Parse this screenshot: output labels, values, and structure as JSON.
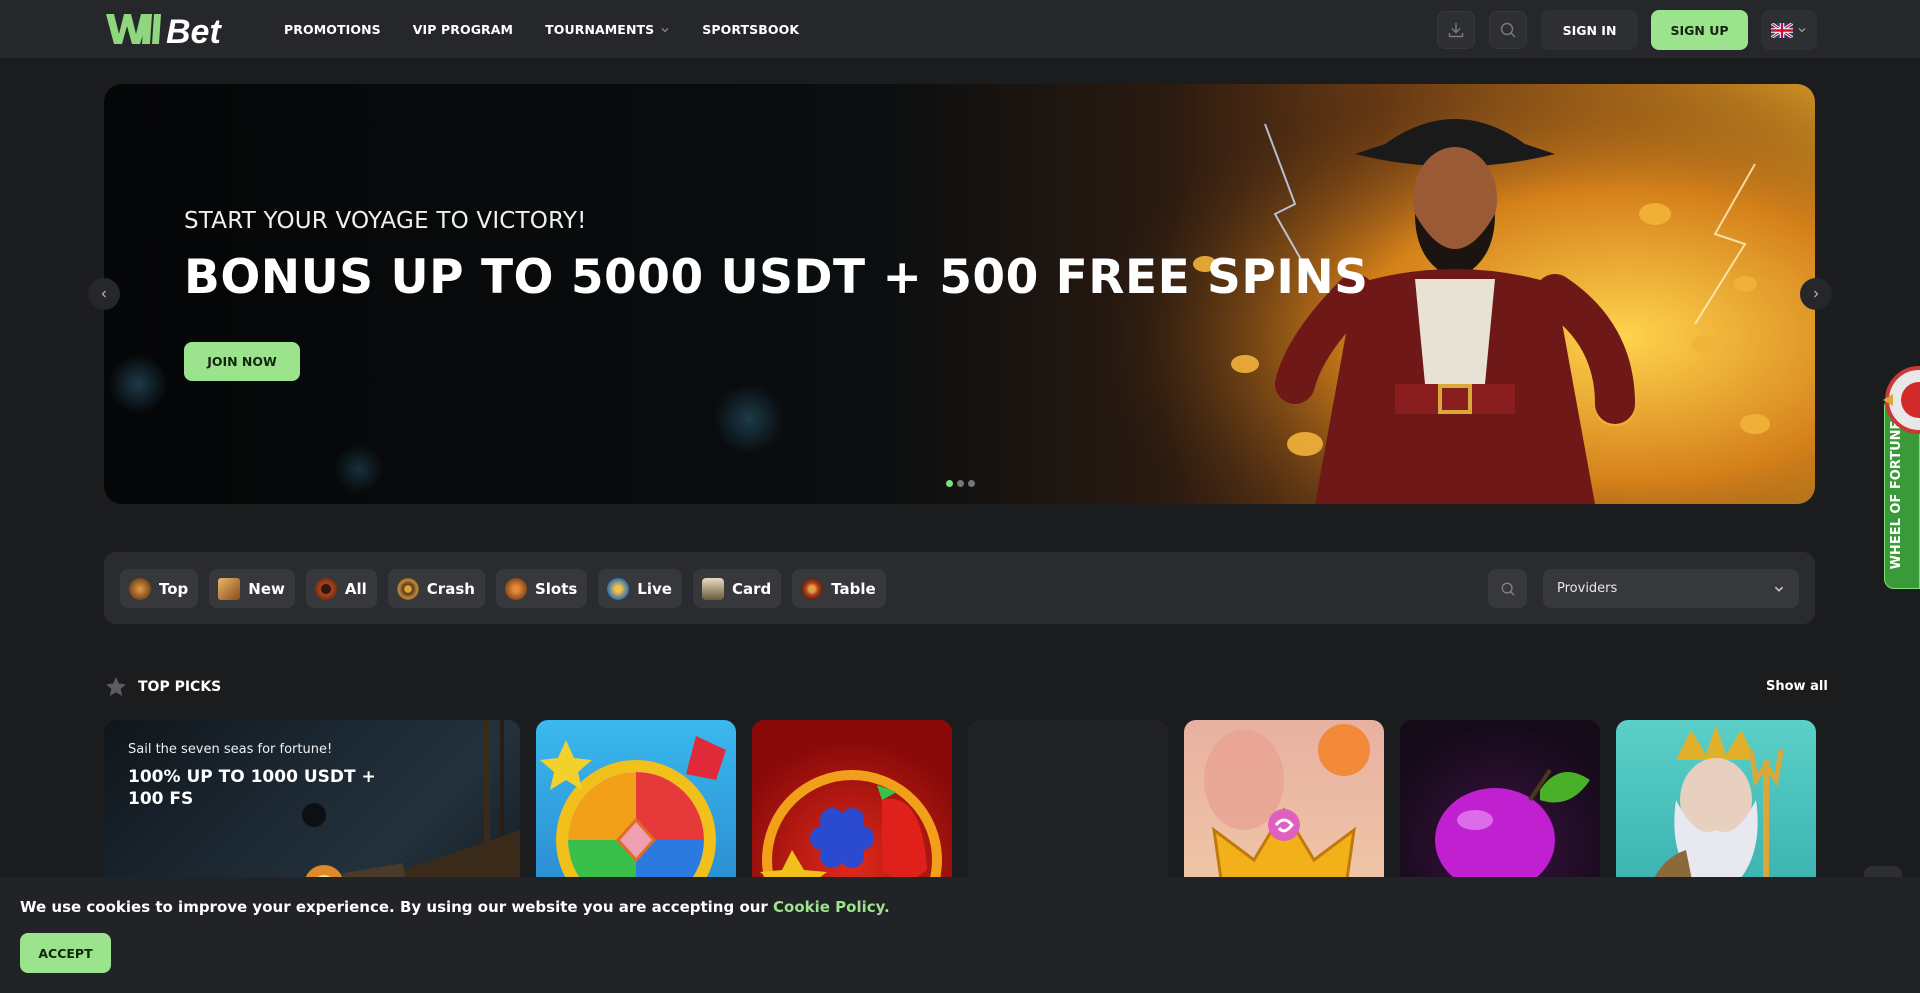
{
  "brand": {
    "logo_text": "WillBet",
    "accent": "#9be38c"
  },
  "nav": {
    "items": [
      {
        "label": "PROMOTIONS"
      },
      {
        "label": "VIP PROGRAM"
      },
      {
        "label": "TOURNAMENTS"
      },
      {
        "label": "SPORTSBOOK"
      }
    ]
  },
  "header": {
    "download_icon": "download-icon",
    "search_icon": "search-icon",
    "signin_label": "SIGN IN",
    "signup_label": "SIGN UP",
    "language_icon": "uk-flag-icon"
  },
  "hero": {
    "subtitle": "START YOUR VOYAGE TO VICTORY!",
    "title": "BONUS UP TO 5000 USDT + 500 FREE SPINS",
    "cta_label": "JOIN NOW",
    "slides_count": 3,
    "active_slide": 1
  },
  "categories": {
    "items": [
      {
        "label": "Top",
        "icon": "chest-icon",
        "color": "#b06a2a"
      },
      {
        "label": "New",
        "icon": "treasure-map-icon",
        "color": "#c57a2c"
      },
      {
        "label": "All",
        "icon": "compass-icon",
        "color": "#a33b1b"
      },
      {
        "label": "Crash",
        "icon": "ship-wheel-icon",
        "color": "#8a6a30"
      },
      {
        "label": "Slots",
        "icon": "barrel-icon",
        "color": "#9a4a1e"
      },
      {
        "label": "Live",
        "icon": "parrot-icon",
        "color": "#2a6fb0"
      },
      {
        "label": "Card",
        "icon": "skull-card-icon",
        "color": "#8b7a5a"
      },
      {
        "label": "Table",
        "icon": "roulette-icon",
        "color": "#b0401e"
      }
    ],
    "providers_placeholder": "Providers"
  },
  "top_picks": {
    "title": "TOP PICKS",
    "show_all_label": "Show all",
    "promo": {
      "subtitle": "Sail the seven seas for fortune!",
      "title": "100% UP TO 1000 USDT + 100 FS"
    },
    "games": [
      {
        "name": "candy-pinwheel-game",
        "color": "#3aa8e0"
      },
      {
        "name": "fruit-fire-game",
        "color": "#b81212"
      },
      {
        "name": "loading-game",
        "color": "#202226"
      },
      {
        "name": "crown-candy-game",
        "color": "#e6a27a"
      },
      {
        "name": "plum-game",
        "color": "#2a0f2e"
      },
      {
        "name": "poseidon-game",
        "color": "#4ac4c0"
      }
    ]
  },
  "wheel": {
    "label": "WHEEL OF FORTUNE"
  },
  "cookie": {
    "text": "We use cookies to improve your experience. By using our website you are accepting our ",
    "link_label": "Cookie Policy.",
    "accept_label": "ACCEPT"
  }
}
